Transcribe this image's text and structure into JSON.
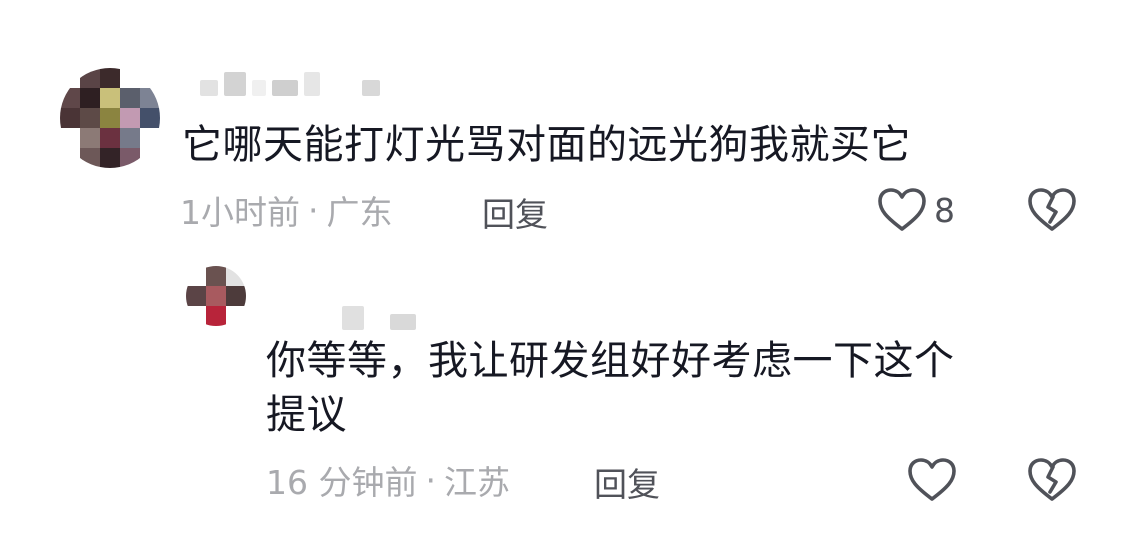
{
  "comments": [
    {
      "text": "它哪天能打灯光骂对面的远光狗我就买它",
      "time": "1小时前",
      "separator": "·",
      "location": "广东",
      "reply_label": "回复",
      "like_count": "8",
      "like_icon": "heart-outline-icon",
      "dislike_icon": "broken-heart-icon",
      "avatar_mosaic_colors": [
        "#ffffff",
        "#5a4446",
        "#3c2a2b",
        "#ffffff",
        "#ffffff",
        "#5f4749",
        "#2e1f22",
        "#c9c07a",
        "#5b5f6c",
        "#7d8394",
        "#4a3436",
        "#5d4a47",
        "#8b8440",
        "#c29ab2",
        "#44506a",
        "#ffffff",
        "#8c7a76",
        "#6b3140",
        "#767a8a",
        "#ffffff",
        "#ffffff",
        "#6d5858",
        "#332327",
        "#7a5a69",
        "#ffffff"
      ],
      "name_blur_colors": [
        "#e2e2e2",
        "#d3d3d3",
        "#f0f0f0",
        "#cfcfcf",
        "#e6e6e6",
        "#ffffff",
        "#d8d8d8"
      ]
    },
    {
      "text": "你等等，我让研发组好好考虑一下这个\n提议",
      "time": "16 分钟前",
      "separator": "·",
      "location": "江苏",
      "reply_label": "回复",
      "like_count": "",
      "like_icon": "heart-outline-icon",
      "dislike_icon": "broken-heart-icon",
      "avatar_mosaic_colors": [
        "#ffffff",
        "#6a5250",
        "#e2e2e2",
        "#5b4446",
        "#a85a5f",
        "#4d3b3b",
        "#ffffff",
        "#b8243a",
        "#ffffff"
      ],
      "name_blur_colors": [
        "#ffffff",
        "#e0e0e0",
        "#ffffff",
        "#d9d9d9"
      ]
    }
  ]
}
